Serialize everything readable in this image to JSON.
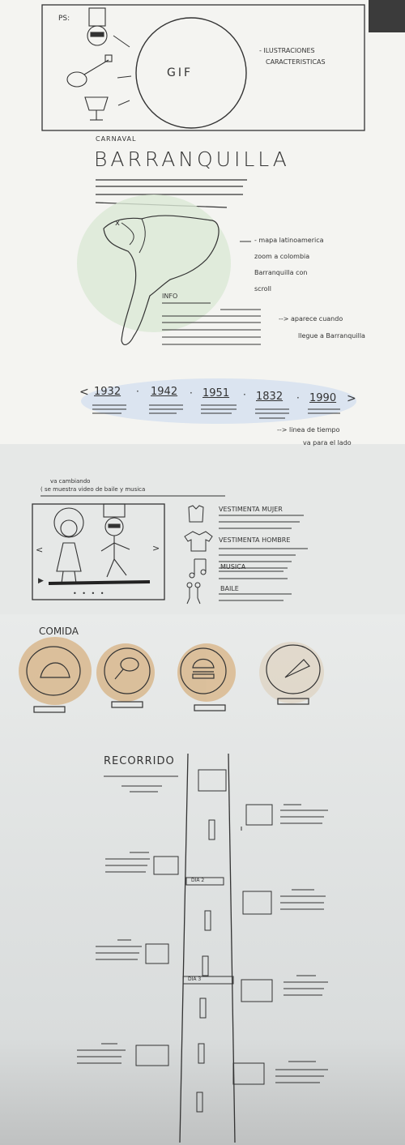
{
  "top": {
    "ps_label": "PS:",
    "gif_label": "GIF",
    "note": [
      "- ILUSTRACIONES",
      "CARACTERISTICAS"
    ]
  },
  "title": {
    "kicker": "CARNAVAL",
    "main": "BARRANQUILLA"
  },
  "map": {
    "marker": "x",
    "info_label": "INFO",
    "note": [
      "- mapa latinoamerica",
      "zoom a colombia",
      "Barranquilla con",
      "scroll"
    ],
    "info_note": [
      "--> aparece cuando",
      "llegue a Barranquilla"
    ]
  },
  "timeline": {
    "prev": "<",
    "next": ">",
    "years": [
      "1932",
      "1942",
      "1951",
      "1832",
      "1990"
    ],
    "note": [
      "--> linea de tiempo",
      "va para el lado"
    ]
  },
  "video": {
    "note": [
      "va cambiando",
      "( se muestra video de baile y musica"
    ],
    "prev": "<",
    "next": ">",
    "play": "▶",
    "dots": "• • • •"
  },
  "categories": [
    {
      "icon": "shirt-icon",
      "label": "VESTIMENTA MUJER"
    },
    {
      "icon": "tshirt-icon",
      "label": "VESTIMENTA HOMBRE"
    },
    {
      "icon": "music-note-icon",
      "label": "MUSICA"
    },
    {
      "icon": "dancers-icon",
      "label": "BAILE"
    }
  ],
  "food": {
    "heading": "COMIDA",
    "items": [
      "taco-icon",
      "drumstick-icon",
      "burger-icon",
      "pizza-icon"
    ]
  },
  "route": {
    "heading": "RECORRIDO",
    "day1": "DIA 2",
    "day2": "DIA 3"
  },
  "colors": {
    "map_glow": "#dbe8d6",
    "timeline_glow": "#d8e2ef",
    "food_glow": "#d9b88e"
  }
}
